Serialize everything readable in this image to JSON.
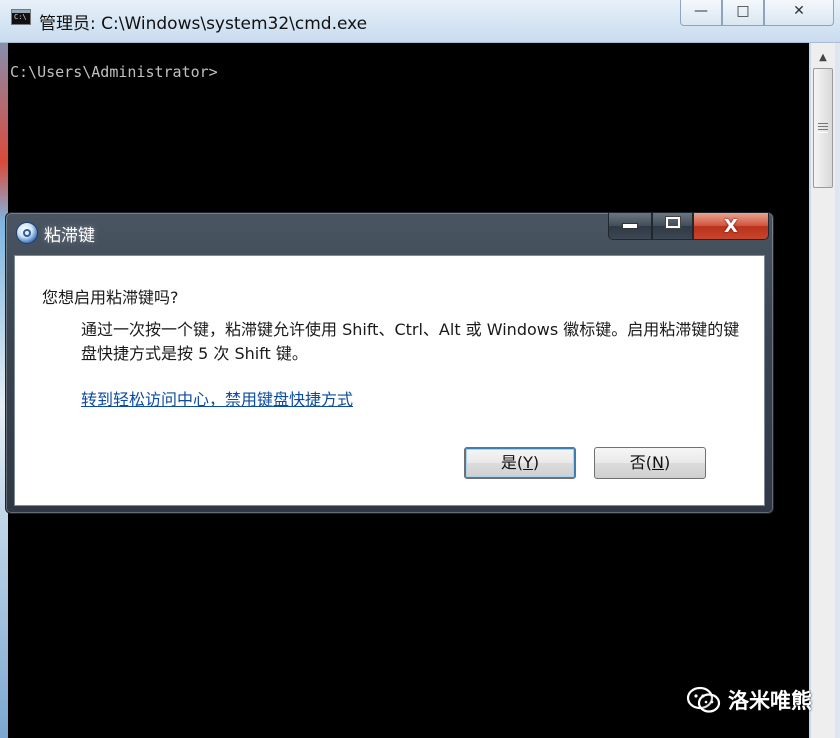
{
  "cmd": {
    "title": "管理员: C:\\Windows\\system32\\cmd.exe",
    "prompt": "C:\\Users\\Administrator>",
    "buttons": {
      "minimize": "—",
      "maximize": "□",
      "close": "✕"
    }
  },
  "dialog": {
    "title": "粘滞键",
    "question": "您想启用粘滞键吗?",
    "description": "通过一次按一个键，粘滞键允许使用 Shift、Ctrl、Alt 或 Windows 徽标键。启用粘滞键的键盘快捷方式是按 5 次 Shift 键。",
    "link": "转到轻松访问中心，禁用键盘快捷方式",
    "yes_label": "是(",
    "yes_mnemonic": "Y",
    "no_label": "否(",
    "no_mnemonic": "N",
    "close_glyph": "X"
  },
  "watermark": {
    "text": "洛米唯熊"
  },
  "icons": {
    "cmd": "cmd-icon",
    "dialog": "ease-of-access-icon",
    "watermark": "wechat-icon"
  }
}
